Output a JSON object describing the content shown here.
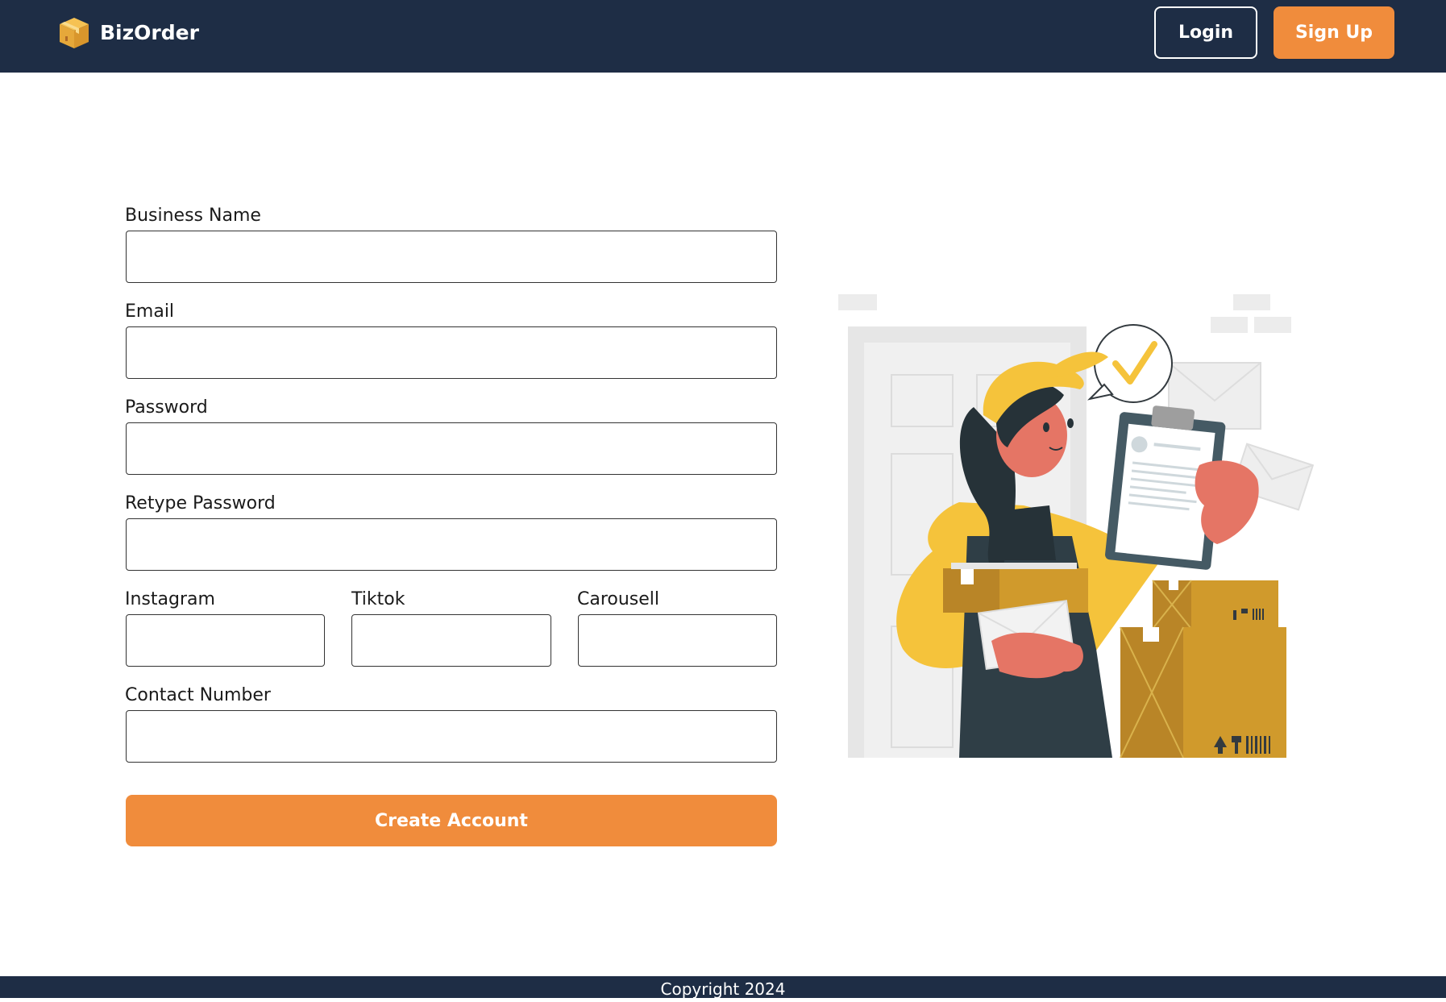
{
  "header": {
    "brand": "BizOrder",
    "login_label": "Login",
    "signup_label": "Sign Up"
  },
  "form": {
    "business_name_label": "Business Name",
    "email_label": "Email",
    "password_label": "Password",
    "retype_password_label": "Retype Password",
    "instagram_label": "Instagram",
    "tiktok_label": "Tiktok",
    "carousell_label": "Carousell",
    "contact_number_label": "Contact Number",
    "submit_label": "Create Account"
  },
  "footer": {
    "copyright": "Copyright 2024"
  },
  "colors": {
    "navbar": "#1e2d45",
    "accent": "#f08c3c"
  },
  "icons": {
    "logo": "package-box-icon"
  }
}
